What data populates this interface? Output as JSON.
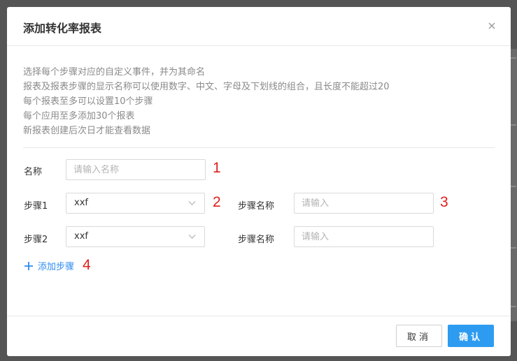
{
  "dialog": {
    "title": "添加转化率报表",
    "close_icon": "close-icon"
  },
  "description": [
    "选择每个步骤对应的自定义事件，并为其命名",
    "报表及报表步骤的显示名称可以使用数字、中文、字母及下划线的组合，且长度不能超过20",
    "每个报表至多可以设置10个步骤",
    "每个应用至多添加30个报表",
    "新报表创建后次日才能查看数据"
  ],
  "form": {
    "name_label": "名称",
    "name_placeholder": "请输入名称",
    "name_value": "",
    "steps": [
      {
        "label": "步骤1",
        "event_value": "xxf",
        "name_label": "步骤名称",
        "name_placeholder": "请输入",
        "name_value": ""
      },
      {
        "label": "步骤2",
        "event_value": "xxf",
        "name_label": "步骤名称",
        "name_placeholder": "请输入",
        "name_value": ""
      }
    ],
    "add_step_label": "添加步骤"
  },
  "annotations": [
    "1",
    "2",
    "3",
    "4"
  ],
  "footer": {
    "cancel_label": "取消",
    "confirm_label": "确认"
  },
  "colors": {
    "accent": "#2d9cf0",
    "annotation": "#e02020",
    "overlay": "#555555"
  }
}
